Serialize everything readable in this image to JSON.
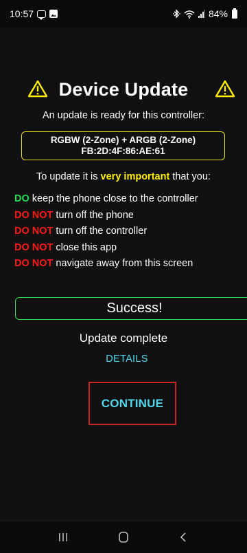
{
  "status_bar": {
    "time": "10:57",
    "battery_percent": "84%",
    "left_icons": [
      "message-icon",
      "image-icon"
    ],
    "right_icons": [
      "bluetooth-icon",
      "wifi-icon",
      "signal-icon",
      "battery-icon"
    ]
  },
  "header": {
    "title": "Device Update",
    "icon": "warning-icon"
  },
  "subtitle": "An update is ready for this controller:",
  "device": {
    "name": "RGBW (2-Zone) + ARGB (2-Zone)",
    "mac": "FB:2D:4F:86:AE:61"
  },
  "instructions": {
    "prefix": "To update it is ",
    "highlight": "very important",
    "suffix": " that you:",
    "rules": [
      {
        "tag": "DO",
        "text": " keep the phone close to the controller"
      },
      {
        "tag": "DO NOT",
        "text": " turn off the phone"
      },
      {
        "tag": "DO NOT",
        "text": " turn off the controller"
      },
      {
        "tag": "DO NOT",
        "text": " close this app"
      },
      {
        "tag": "DO NOT",
        "text": " navigate away from this screen"
      }
    ]
  },
  "result": {
    "banner": "Success!",
    "status": "Update complete",
    "details_label": "DETAILS",
    "continue_label": "CONTINUE"
  },
  "nav_bar": {
    "buttons": [
      "recents-icon",
      "home-icon",
      "back-icon"
    ]
  },
  "colors": {
    "background": "#101010",
    "accent_cyan": "#4fd7ee",
    "warning_yellow": "#ffee00",
    "success_green": "#2fd94a",
    "danger_red": "#ff1a1a",
    "highlight_border": "#c8262b"
  }
}
